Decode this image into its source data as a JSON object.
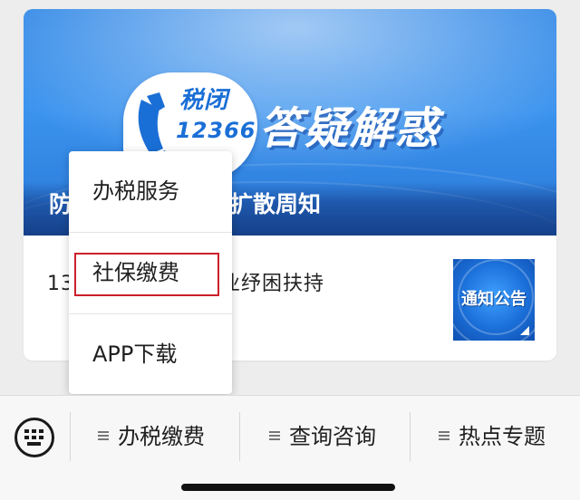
{
  "banner": {
    "logo_line1": "税闭",
    "logo_line2": "12366",
    "title": "答疑解惑",
    "caption": "防疫费热点答疑，扩散周知"
  },
  "article": {
    "text": "13项费老托育服务业纾困扶持",
    "thumb_label": "通知公告"
  },
  "popup_menu": {
    "items": [
      "办税服务",
      "社保缴费",
      "APP下载"
    ],
    "highlighted_index": 1,
    "highlight_color": "#cc1f2b"
  },
  "bottom_menu": {
    "keyboard_icon": "keyboard-icon",
    "items": [
      "办税缴费",
      "查询咨询",
      "热点专题"
    ]
  },
  "colors": {
    "banner_blue": "#2e86e6",
    "background": "#ededed"
  }
}
